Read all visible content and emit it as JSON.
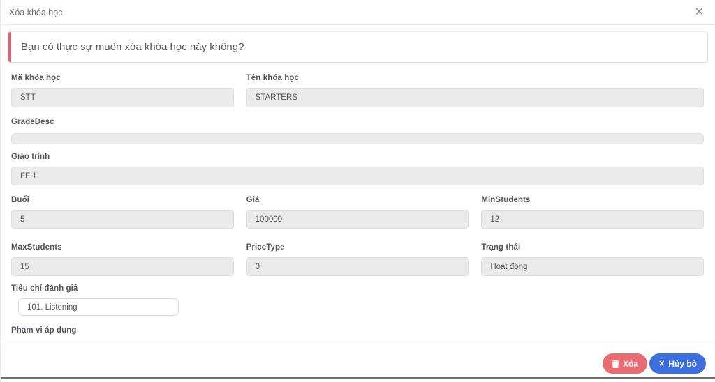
{
  "modal": {
    "title": "Xóa khóa học",
    "close_icon": "✕",
    "confirm_message": "Bạn có thực sự muốn xóa khóa học này không?"
  },
  "form": {
    "fields": [
      {
        "label": "Mã khóa học",
        "value": "STT"
      },
      {
        "label": "Tên khóa học",
        "value": "STARTERS"
      },
      {
        "label": "GradeDesc",
        "value": ""
      },
      {
        "label": "Giáo trình",
        "value": "FF 1"
      },
      {
        "label": "Buổi",
        "value": "5"
      },
      {
        "label": "Giá",
        "value": "100000"
      },
      {
        "label": "MinStudents",
        "value": "12"
      },
      {
        "label": "MaxStudents",
        "value": "15"
      },
      {
        "label": "PriceType",
        "value": "0"
      },
      {
        "label": "Trạng thái",
        "value": "Hoạt động"
      },
      {
        "label": "Tiêu chí đánh giá",
        "value": "101. Listening"
      },
      {
        "label": "Phạm vi áp dụng"
      }
    ]
  },
  "footer": {
    "delete_label": "Xóa",
    "cancel_label": "Hủy bỏ",
    "cancel_icon": "✕"
  },
  "colors": {
    "alert_border": "#e4606d",
    "delete_button": "#ea6c73",
    "cancel_button": "#3d6ee0",
    "input_background": "#ebebeb"
  }
}
